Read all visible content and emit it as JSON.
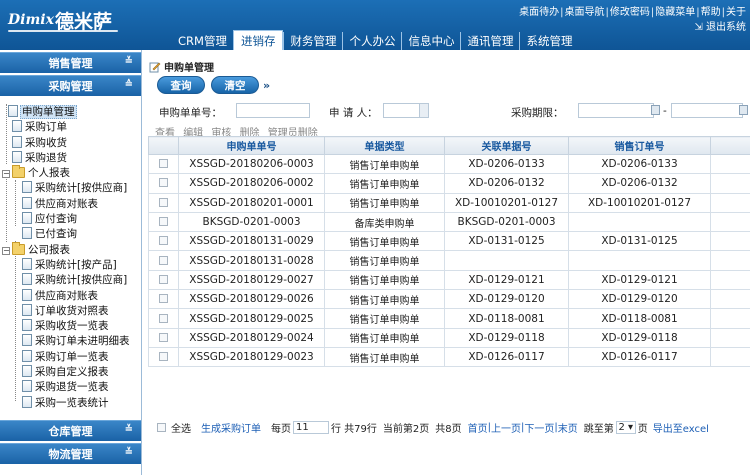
{
  "header": {
    "logo_latin": "Dimix",
    "logo_cn": "德米萨",
    "links": [
      "桌面待办",
      "桌面导航",
      "修改密码",
      "隐藏菜单",
      "帮助",
      "关于"
    ],
    "logout": "退出系统",
    "nav": [
      "CRM管理",
      "进销存",
      "财务管理",
      "个人办公",
      "信息中心",
      "通讯管理",
      "系统管理"
    ]
  },
  "sidebar": {
    "sections": {
      "sales": "销售管理",
      "purchase": "采购管理",
      "warehouse": "仓库管理",
      "logistics": "物流管理"
    },
    "items": {
      "req": "申购单管理",
      "order": "采购订单",
      "receive": "采购收货",
      "return": "采购退货",
      "personal": "个人报表",
      "p_stat": "采购统计[按供应商]",
      "p_supplier": "供应商对账表",
      "p_payable": "应付查询",
      "p_paid": "已付查询",
      "company": "公司报表",
      "c_stat_prod": "采购统计[按产品]",
      "c_stat_sup": "采购统计[按供应商]",
      "c_supplier": "供应商对账表",
      "c_orderrec": "订单收货对照表",
      "c_recvlist": "采购收货一览表",
      "c_detail": "采购订单未进明细表",
      "c_orderlist": "采购订单一览表",
      "c_custom": "采购自定义报表",
      "c_retlist": "采购退货一览表",
      "c_summary": "采购一览表统计"
    }
  },
  "main": {
    "title": "申购单管理",
    "query_btn": "查询",
    "clear_btn": "清空",
    "expand": "»",
    "filters": {
      "req_no": "申购单单号：",
      "applicant": "申 请 人：",
      "period": "采购期限："
    },
    "date_sep": "-",
    "actions": [
      "查看",
      "编辑",
      "审核",
      "删除",
      "管理员删除"
    ],
    "columns": [
      "申购单单号",
      "单据类型",
      "关联单据号",
      "销售订单号"
    ],
    "rows": [
      [
        "XSSGD-20180206-0003",
        "销售订单申购单",
        "XD-0206-0133",
        "XD-0206-0133"
      ],
      [
        "XSSGD-20180206-0002",
        "销售订单申购单",
        "XD-0206-0132",
        "XD-0206-0132"
      ],
      [
        "XSSGD-20180201-0001",
        "销售订单申购单",
        "XD-10010201-0127",
        "XD-10010201-0127"
      ],
      [
        "BKSGD-0201-0003",
        "备库类申购单",
        "BKSGD-0201-0003",
        ""
      ],
      [
        "XSSGD-20180131-0029",
        "销售订单申购单",
        "XD-0131-0125",
        "XD-0131-0125"
      ],
      [
        "XSSGD-20180131-0028",
        "销售订单申购单",
        "",
        ""
      ],
      [
        "XSSGD-20180129-0027",
        "销售订单申购单",
        "XD-0129-0121",
        "XD-0129-0121"
      ],
      [
        "XSSGD-20180129-0026",
        "销售订单申购单",
        "XD-0129-0120",
        "XD-0129-0120"
      ],
      [
        "XSSGD-20180129-0025",
        "销售订单申购单",
        "XD-0118-0081",
        "XD-0118-0081"
      ],
      [
        "XSSGD-20180129-0024",
        "销售订单申购单",
        "XD-0129-0118",
        "XD-0129-0118"
      ],
      [
        "XSSGD-20180129-0023",
        "销售订单申购单",
        "XD-0126-0117",
        "XD-0126-0117"
      ]
    ],
    "pager": {
      "select_all": "全选",
      "gen_order": "生成采购订单",
      "per_page_label": "每页",
      "per_page": "11",
      "rows_total": "行 共79行",
      "current": "当前第2页",
      "pages_total": "共8页",
      "first": "首页",
      "prev": "上一页",
      "next": "下一页",
      "last": "末页",
      "goto_label": "跳至第",
      "goto_page": "2",
      "page_suffix": "页",
      "export": "导出至excel"
    }
  }
}
